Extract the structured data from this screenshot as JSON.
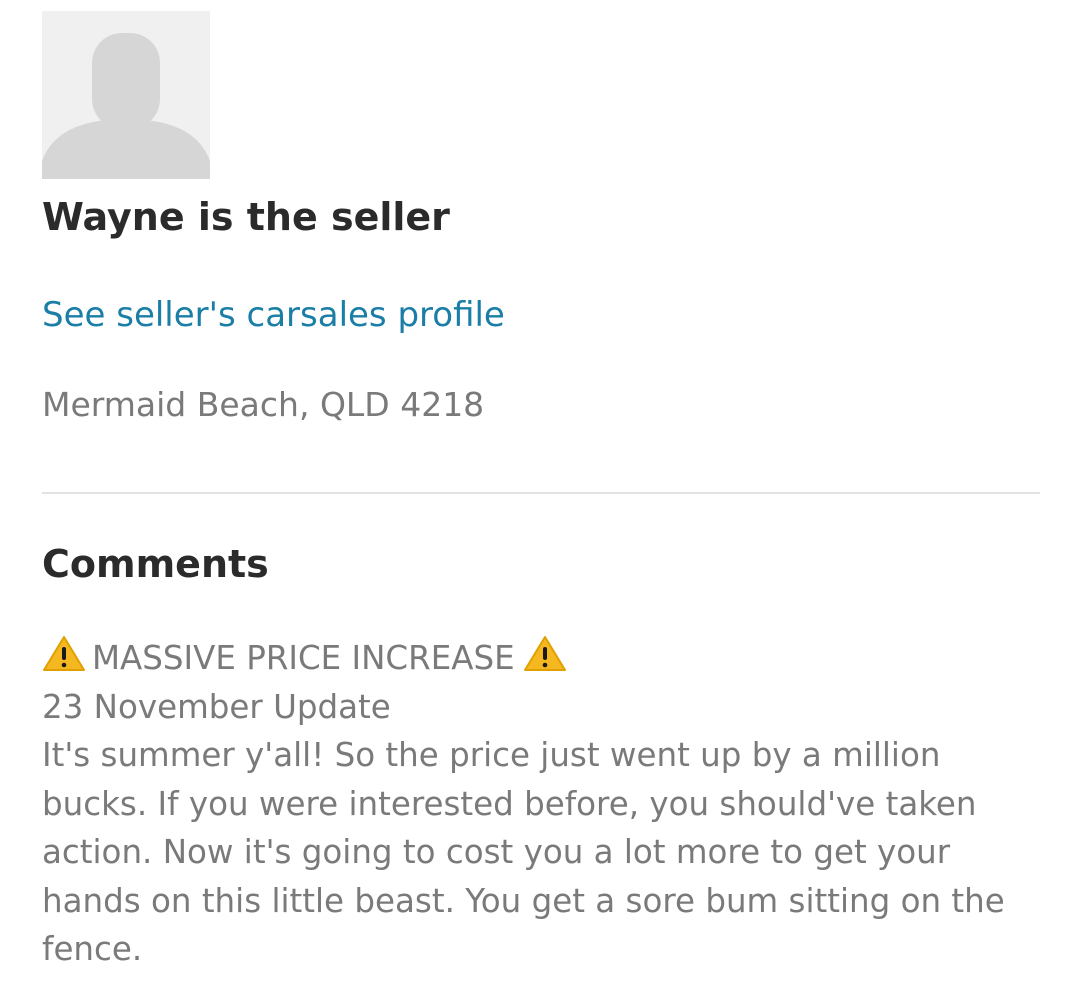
{
  "seller": {
    "name_heading": "Wayne is the seller",
    "profile_link": "See seller's carsales profile",
    "location": "Mermaid Beach, QLD 4218"
  },
  "comments": {
    "title": "Comments",
    "headline": "MASSIVE PRICE INCREASE",
    "headline_icon": "warning-icon",
    "update_line": "23 November Update",
    "text": "It's summer y'all! So the price just went up by a million bucks. If you were interested before, you should've taken action. Now it's going to cost you a lot more to get your hands on this little beast. You get a sore bum sitting on the fence."
  },
  "colors": {
    "heading": "#2b2b2b",
    "link": "#1a7ea6",
    "muted_text": "#7a7a7a",
    "divider": "#e3e3e3",
    "avatar_bg": "#f0f0f0",
    "warning": "#f5b820"
  }
}
